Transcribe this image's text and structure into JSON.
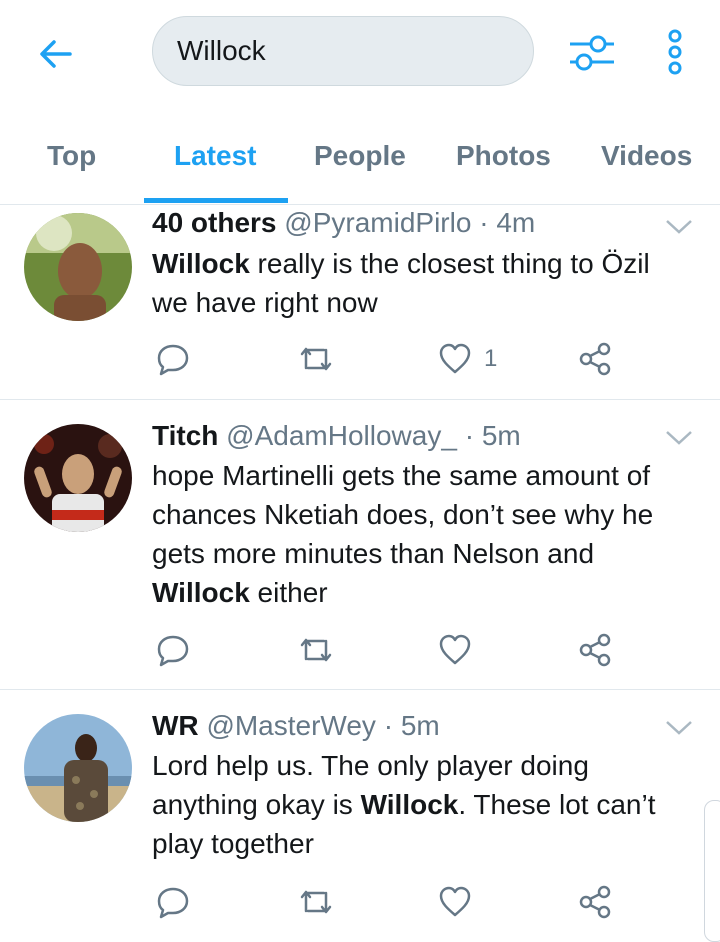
{
  "search": {
    "query": "Willock"
  },
  "tabs": [
    {
      "label": "Top"
    },
    {
      "label": "Latest"
    },
    {
      "label": "People"
    },
    {
      "label": "Photos"
    },
    {
      "label": "Videos"
    }
  ],
  "active_tab": "Latest",
  "colors": {
    "accent": "#1da1f2",
    "muted": "#657786",
    "divider": "#e1e8ed"
  },
  "tweets": [
    {
      "name": "40 others",
      "handle": "@PyramidPirlo",
      "sep": "·",
      "time": "4m",
      "text_b1": "Willock",
      "text_1": " really is the closest thing to Özil we have right now",
      "like_count": "1"
    },
    {
      "name": "Titch",
      "handle": "@AdamHolloway_",
      "sep": "·",
      "time": "5m",
      "text_1": "hope Martinelli gets the same amount of chances Nketiah does, don’t see why he gets more minutes than Nelson and ",
      "text_b1": "Willock",
      "text_2": " either",
      "like_count": ""
    },
    {
      "name": "WR",
      "handle": "@MasterWey",
      "sep": "·",
      "time": "5m",
      "text_1": "Lord help us. The only player doing anything okay is ",
      "text_b1": "Willock",
      "text_2": ". These lot can’t play together",
      "like_count": ""
    }
  ],
  "icons": [
    "back-arrow-icon",
    "filter-sliders-icon",
    "more-vertical-icon",
    "reply-icon",
    "retweet-icon",
    "like-heart-icon",
    "share-icon",
    "caret-down-icon"
  ]
}
